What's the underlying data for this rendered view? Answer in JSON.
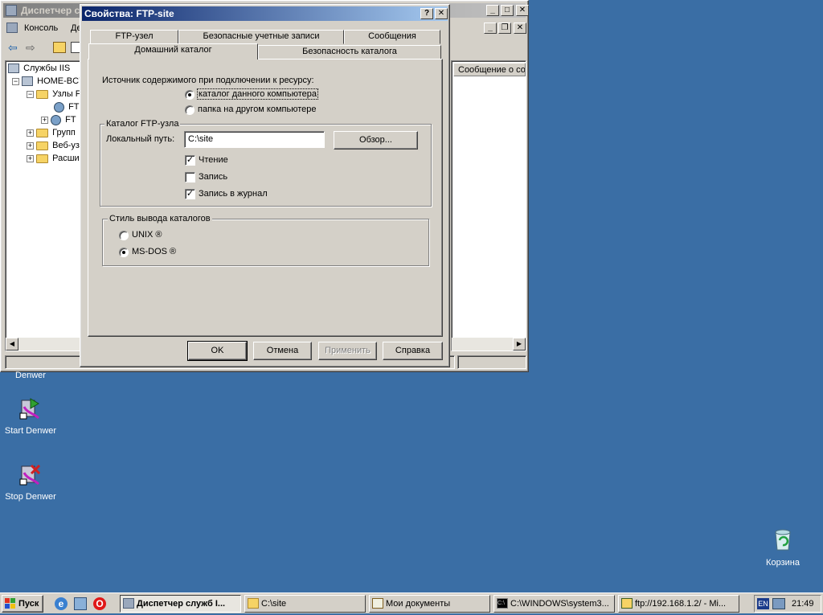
{
  "bg_window": {
    "title": "Диспетчер с",
    "menu": [
      "Консоль",
      "Де"
    ],
    "tree": [
      {
        "label": "Службы IIS"
      },
      {
        "label": "HOME-BC7"
      },
      {
        "label": "Узлы F"
      },
      {
        "label": "FT"
      },
      {
        "label": "FT"
      },
      {
        "label": "Групп"
      },
      {
        "label": "Веб-уз"
      },
      {
        "label": "Расши"
      }
    ],
    "column_header": "Сообщение о сос"
  },
  "dialog": {
    "title": "Свойства: FTP-site",
    "help_glyph": "?",
    "close_glyph": "✕",
    "tabs_row1": [
      "FTP-узел",
      "Безопасные учетные записи",
      "Сообщения"
    ],
    "tabs_row2": [
      "Домашний каталог",
      "Безопасность каталога"
    ],
    "active_tab": "Домашний каталог",
    "source_label": "Источник содержимого при подключении к ресурсу:",
    "source_options": [
      "каталог данного компьютера",
      "папка на другом компьютере"
    ],
    "source_selected": 0,
    "group1_label": "Каталог FTP-узла",
    "local_path_label": "Локальный путь:",
    "local_path_value": "C:\\site",
    "browse_label": "Обзор...",
    "permissions": [
      {
        "label": "Чтение",
        "checked": true
      },
      {
        "label": "Запись",
        "checked": false
      },
      {
        "label": "Запись в журнал",
        "checked": true
      }
    ],
    "group2_label": "Стиль вывода каталогов",
    "listing_options": [
      "UNIX ®",
      "MS-DOS ®"
    ],
    "listing_selected": 1,
    "buttons": {
      "ok": "OK",
      "cancel": "Отмена",
      "apply": "Применить",
      "help": "Справка"
    }
  },
  "desktop": {
    "icons": [
      {
        "label": "Denwer"
      },
      {
        "label": "Start Denwer"
      },
      {
        "label": "Stop Denwer"
      },
      {
        "label": "Корзина"
      }
    ]
  },
  "taskbar": {
    "start_label": "Пуск",
    "tasks": [
      {
        "label": "Диспетчер служб I..."
      },
      {
        "label": "C:\\site"
      },
      {
        "label": "Мои документы"
      },
      {
        "label": "C:\\WINDOWS\\system3..."
      },
      {
        "label": "ftp://192.168.1.2/ - Mi..."
      }
    ],
    "lang": "EN",
    "clock": "21:49"
  }
}
